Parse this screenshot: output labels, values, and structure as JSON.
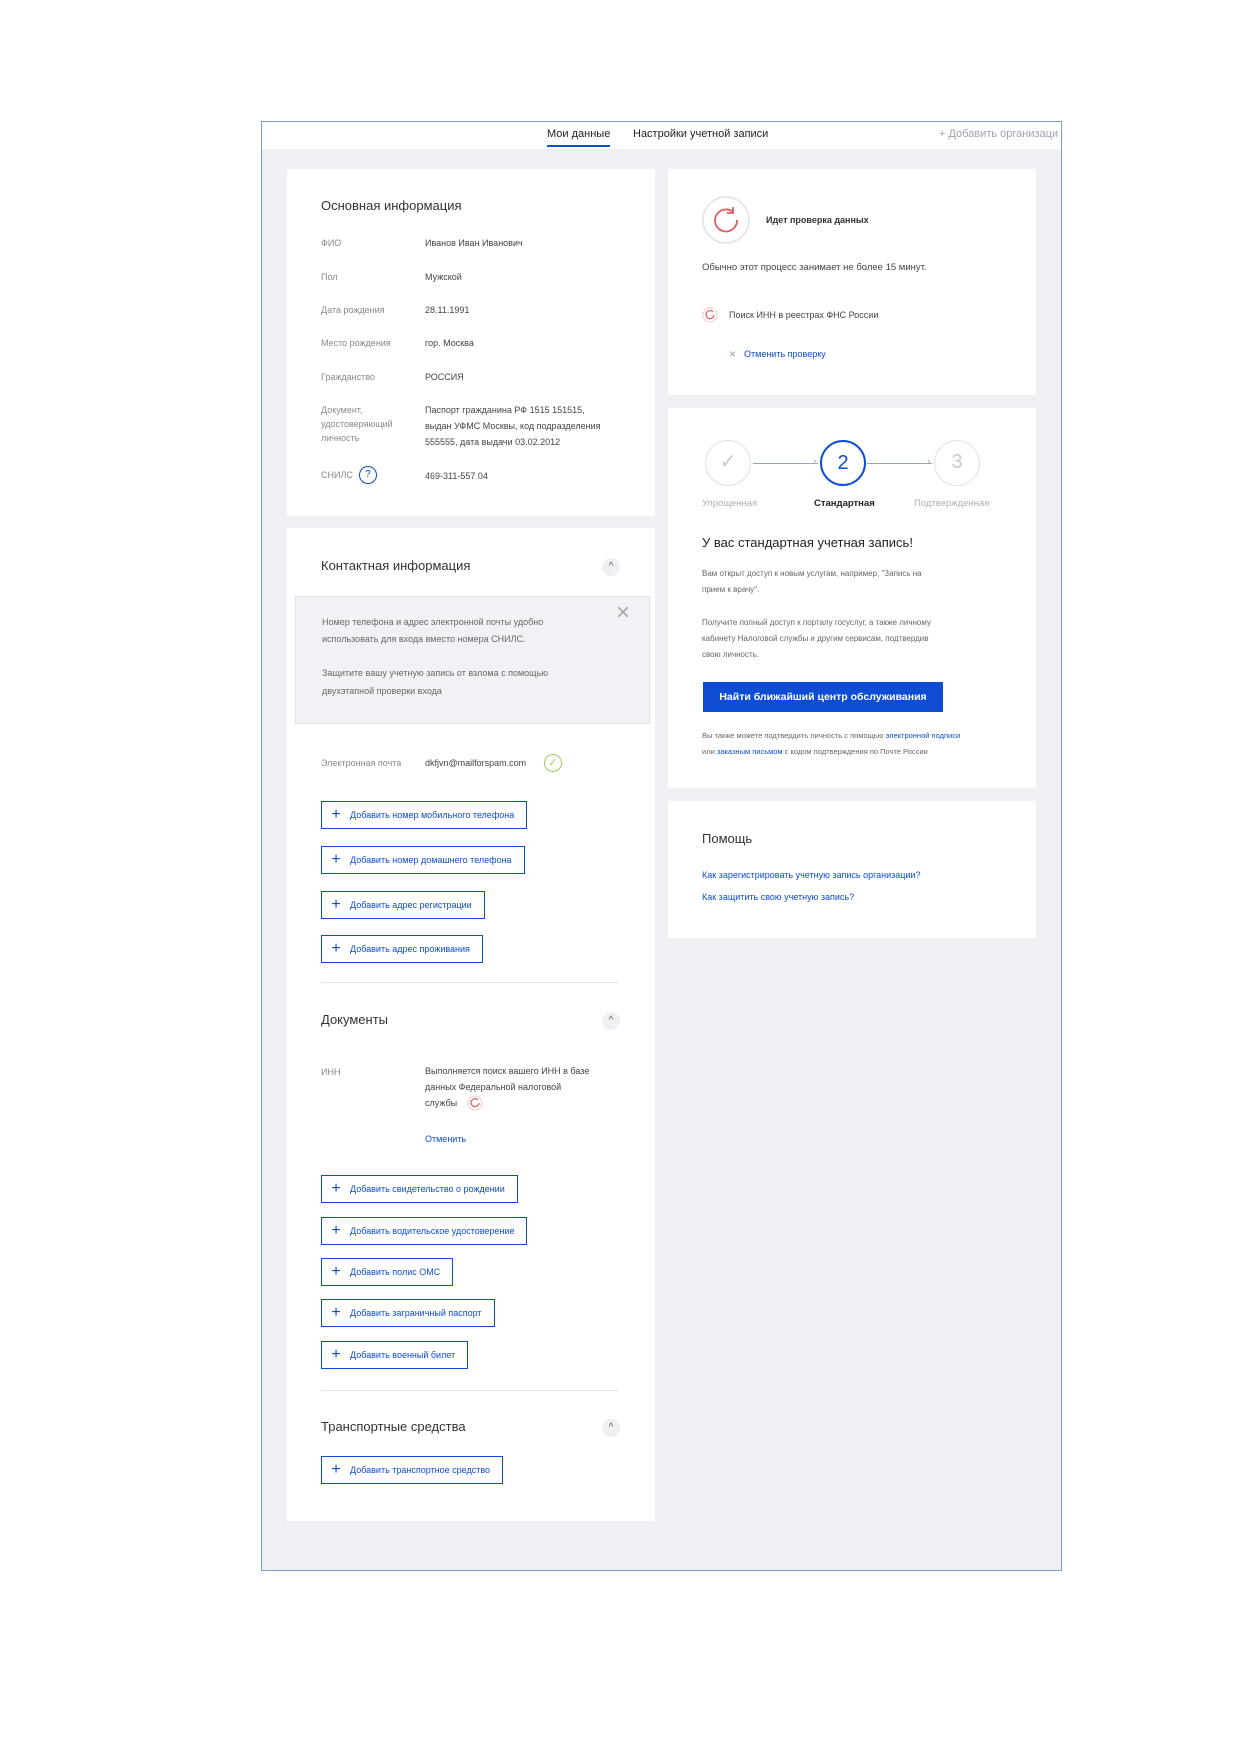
{
  "tabs": {
    "my_data": "Мои данные",
    "account_settings": "Настройки учетной записи",
    "add_org": "+ Добавить организаци"
  },
  "basic": {
    "title": "Основная информация",
    "rows": [
      {
        "label": "ФИО",
        "value": "Иванов Иван Иванович"
      },
      {
        "label": "Пол",
        "value": "Мужской"
      },
      {
        "label": "Дата рождения",
        "value": "28.11.1991"
      },
      {
        "label": "Место рождения",
        "value": "гор. Москва"
      },
      {
        "label": "Гражданство",
        "value": "РОССИЯ"
      },
      {
        "label_lines": [
          "Документ,",
          "удостоверяющий",
          "личность"
        ],
        "value_lines": [
          "Паспорт гражданина РФ 1515 151515,",
          "выдан УФМС Москвы, код подразделения",
          "555555, дата выдачи 03.02.2012"
        ]
      },
      {
        "label": "СНИЛС",
        "help": "?",
        "value": "469-311-557 04"
      }
    ]
  },
  "contact": {
    "title": "Контактная информация",
    "chevron": "^",
    "notice": {
      "line1": "Номер телефона и адрес электронной почты удобно",
      "line2": "использовать для входа вместо номера СНИЛС.",
      "line3": "Защитите вашу учетную запись от взлома с помощью",
      "link": "двухэтапной проверки входа",
      "close": "×"
    },
    "email_label": "Электронная почта",
    "email_value": "dkfjvn@mailforspam.com",
    "check": "✓",
    "buttons": [
      "Добавить номер мобильного телефона",
      "Добавить номер домашнего телефона",
      "Добавить адрес регистрации",
      "Добавить адрес проживания"
    ]
  },
  "documents": {
    "title": "Документы",
    "chevron": "^",
    "inn_label": "ИНН",
    "inn_lines": [
      "Выполняется поиск вашего ИНН в базе",
      "данных Федеральной налоговой",
      "службы"
    ],
    "cancel": "Отменить",
    "buttons": [
      "Добавить свидетельство о рождении",
      "Добавить водительское удостоверение",
      "Добавить полис ОМС",
      "Добавить заграничный паспорт",
      "Добавить военный билет"
    ]
  },
  "vehicles": {
    "title": "Транспортные средства",
    "chevron": "^",
    "button": "Добавить транспортное средство"
  },
  "check": {
    "title": "Идет проверка данных",
    "desc": "Обычно этот процесс занимает не более 15 минут.",
    "item": "Поиск ИНН в реестрах ФНС России",
    "cancel": "Отменить проверку",
    "cancel_icon": "×"
  },
  "account": {
    "steps": [
      {
        "num": "✓",
        "label": "Упрощенная"
      },
      {
        "num": "2",
        "label": "Стандартная"
      },
      {
        "num": "3",
        "label": "Подтвержденная"
      }
    ],
    "title": "У вас стандартная учетная запись!",
    "p1_lines": [
      "Вам открыт доступ к новым услугам, например, \"Запись на",
      "прием к врачу\"."
    ],
    "p2_lines": [
      "Получите полный доступ к порталу госуслуг, а также личному",
      "кабинету Налоговой службы и другим сервисам, подтвердив",
      "свою личность."
    ],
    "button": "Найти ближайший центр обслуживания",
    "note1_pre": "Вы также можете подтвердить личность с помощью ",
    "note1_link": "электронной подписи",
    "note2_pre": "или ",
    "note2_link": "заказным письмом",
    "note2_post": " с кодом подтверждения по Почте России"
  },
  "help": {
    "title": "Помощь",
    "links": [
      "Как зарегистрировать учетную запись организации?",
      "Как защитить свою учетную запись?"
    ]
  },
  "colors": {
    "accent": "#0d4cd3",
    "check_green": "#9ccc65",
    "spinner_red": "#e25b63"
  }
}
